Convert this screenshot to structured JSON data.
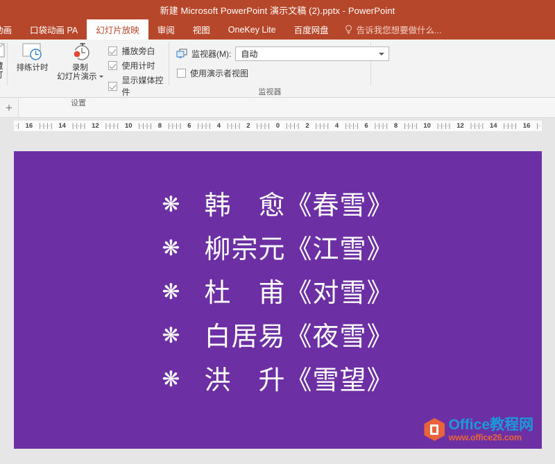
{
  "window": {
    "title": "新建 Microsoft PowerPoint 演示文稿 (2).pptx - PowerPoint",
    "titlebar_color": "#b7472a"
  },
  "ribbon": {
    "tabs": [
      {
        "label": "动画",
        "active": false
      },
      {
        "label": "口袋动画 PA",
        "active": false
      },
      {
        "label": "幻灯片放映",
        "active": true
      },
      {
        "label": "审阅",
        "active": false
      },
      {
        "label": "视图",
        "active": false
      },
      {
        "label": "OneKey Lite",
        "active": false
      },
      {
        "label": "百度网盘",
        "active": false
      }
    ],
    "tell_me": "告诉我您想要做什么...",
    "groups": [
      {
        "name": "hide-slide-group",
        "label": "",
        "buttons": [
          {
            "label_line1": "隐藏",
            "label_line2": "幻灯片",
            "icon": "hide-slide-icon"
          }
        ]
      },
      {
        "name": "setup-group",
        "label": "设置",
        "buttons": [
          {
            "label_line1": "排练计时",
            "label_line2": "",
            "icon": "rehearse-timings-icon"
          },
          {
            "label_line1": "录制",
            "label_line2": "幻灯片演示",
            "icon": "record-slideshow-icon",
            "has_dropdown": true
          }
        ],
        "checkboxes": [
          {
            "label": "播放旁白",
            "checked": true
          },
          {
            "label": "使用计时",
            "checked": true
          },
          {
            "label": "显示媒体控件",
            "checked": true
          }
        ]
      },
      {
        "name": "monitor-group",
        "label": "监视器",
        "monitor_label": "监视器(M):",
        "monitor_icon": "monitor-icon",
        "monitor_value": "自动",
        "monitor_options": [
          "自动"
        ],
        "presenter_view": {
          "label": "使用演示者视图",
          "checked": false
        }
      }
    ]
  },
  "thumbnail_panel": {
    "new_slide_glyph": "+"
  },
  "ruler": {
    "labels_left": [
      "16",
      "14",
      "12",
      "10",
      "8",
      "6",
      "4",
      "2"
    ],
    "center": "0",
    "labels_right": [
      "2",
      "4",
      "6",
      "8",
      "10",
      "12",
      "14",
      "16"
    ]
  },
  "slide": {
    "background_color": "#6C2FA4",
    "text_color": "#FFFFFF",
    "bullet_glyph": "❋",
    "lines": [
      {
        "bullet": "❋",
        "text": "韩　愈《春雪》"
      },
      {
        "bullet": "❋",
        "text": "柳宗元《江雪》"
      },
      {
        "bullet": "❋",
        "text": "杜　甫《对雪》"
      },
      {
        "bullet": "❋",
        "text": "白居易《夜雪》"
      },
      {
        "bullet": "❋",
        "text": "洪　升《雪望》"
      }
    ]
  },
  "watermark": {
    "brand_en": "Office",
    "brand_cn": "教程网",
    "url": "www.office26.com",
    "brand_color": "#1a9bdc",
    "url_color": "#e8633a"
  }
}
